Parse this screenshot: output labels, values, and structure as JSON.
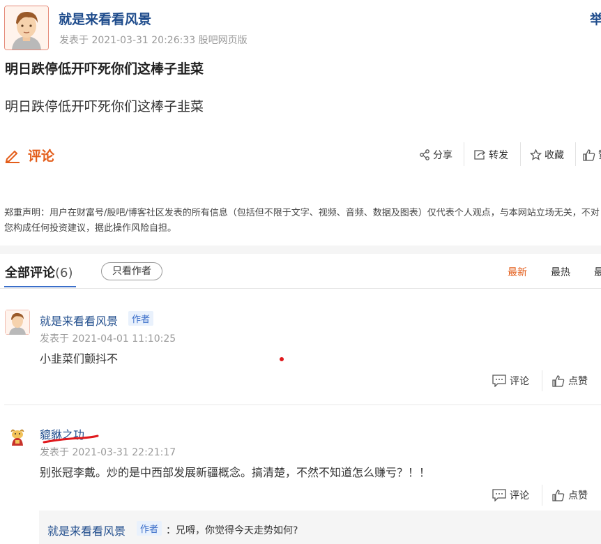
{
  "post": {
    "author": "就是来看看风景",
    "meta": "发表于 2021-03-31 20:26:33 股吧网页版",
    "report": "举",
    "title": "明日跌停低开吓死你们这棒子韭菜",
    "body": "明日跌停低开吓死你们这棒子韭菜"
  },
  "actions": {
    "comment_heading": "评论",
    "share": "分享",
    "forward": "转发",
    "favorite": "收藏",
    "like": "赞"
  },
  "disclaimer": "郑重声明：用户在财富号/股吧/博客社区发表的所有信息（包括但不限于文字、视频、音频、数据及图表）仅代表个人观点，与本网站立场无关，不对您构成任何投资建议，据此操作风险自担。",
  "comments_section": {
    "title": "全部评论",
    "count": "(6)",
    "author_only": "只看作者",
    "sort": [
      "最新",
      "最热",
      "最早"
    ]
  },
  "comments": [
    {
      "name": "就是来看看风景",
      "badge": "作者",
      "meta": "发表于 2021-04-01 11:10:25",
      "text": "小韭菜们颤抖不",
      "reply_label": "评论",
      "like_label": "点赞"
    },
    {
      "name": "貔貅之功",
      "meta": "发表于 2021-03-31 22:21:17",
      "text": "别张冠李戴。炒的是中西部发展新疆概念。搞清楚，不然不知道怎么赚亏？！！",
      "reply_label": "评论",
      "like_label": "点赞"
    }
  ],
  "reply": {
    "name": "就是来看看风景",
    "badge": "作者",
    "text": "：兄嘚，你觉得今天走势如何?"
  },
  "colors": {
    "link_blue": "#1f4c8c",
    "accent_orange": "#e35d1a",
    "tab_blue": "#3a6ec9",
    "annotation_red": "#e0191d"
  }
}
